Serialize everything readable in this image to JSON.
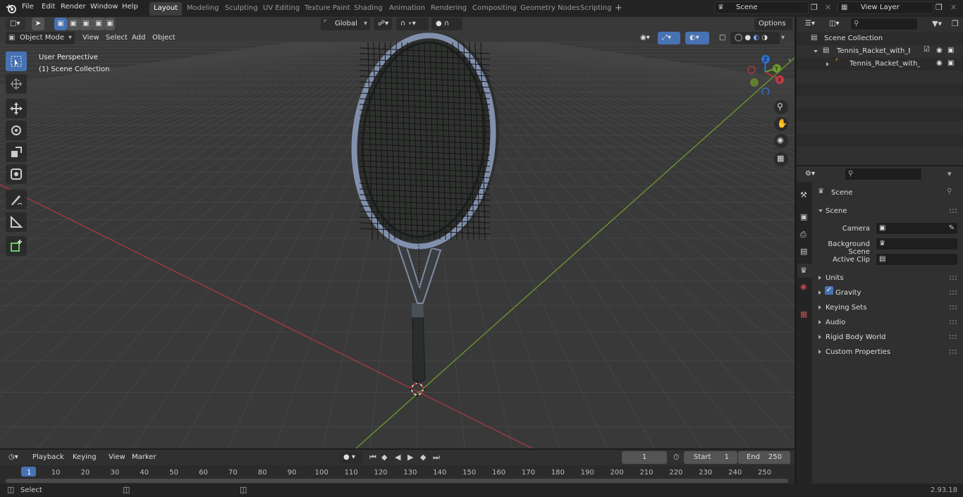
{
  "topbar": {
    "menus": [
      "File",
      "Edit",
      "Render",
      "Window",
      "Help"
    ],
    "workspaces": [
      "Layout",
      "Modeling",
      "Sculpting",
      "UV Editing",
      "Texture Paint",
      "Shading",
      "Animation",
      "Rendering",
      "Compositing",
      "Geometry Nodes",
      "Scripting"
    ],
    "active_workspace": "Layout",
    "add_tab": "+",
    "scene_name": "Scene",
    "view_layer": "View Layer"
  },
  "viewport_header": {
    "transform_orientation": "Global",
    "options_label": "Options",
    "mode": "Object Mode",
    "menus": [
      "View",
      "Select",
      "Add",
      "Object"
    ]
  },
  "viewport": {
    "overlay_line1": "User Perspective",
    "overlay_line2": "(1) Scene Collection",
    "gizmo_axes": {
      "x": "X",
      "y": "Y",
      "z": "Z"
    }
  },
  "outliner": {
    "root": "Scene Collection",
    "items": [
      {
        "label": "Tennis_Racket_with_Blue_Fra"
      },
      {
        "label": "Tennis_Racket_with_Blue"
      }
    ]
  },
  "properties": {
    "context_title": "Scene",
    "section": "Scene",
    "fields": [
      {
        "label": "Camera"
      },
      {
        "label": "Background Scene"
      },
      {
        "label": "Active Clip"
      }
    ],
    "panels": [
      "Units",
      "Gravity",
      "Keying Sets",
      "Audio",
      "Rigid Body World",
      "Custom Properties"
    ]
  },
  "timeline": {
    "menus": [
      "Playback",
      "Keying",
      "View",
      "Marker"
    ],
    "current_frame": "1",
    "start_label": "Start",
    "start_value": "1",
    "end_label": "End",
    "end_value": "250",
    "ruler": [
      "1",
      "10",
      "20",
      "30",
      "40",
      "50",
      "60",
      "70",
      "80",
      "90",
      "100",
      "110",
      "120",
      "130",
      "140",
      "150",
      "160",
      "170",
      "180",
      "190",
      "200",
      "210",
      "220",
      "230",
      "240",
      "250"
    ]
  },
  "statusbar": {
    "left": "Select",
    "version": "2.93.18"
  },
  "colors": {
    "accent": "#4772b3",
    "x_axis": "#a83a3f",
    "y_axis": "#6d9a2c",
    "z_axis": "#2f6ed1"
  }
}
